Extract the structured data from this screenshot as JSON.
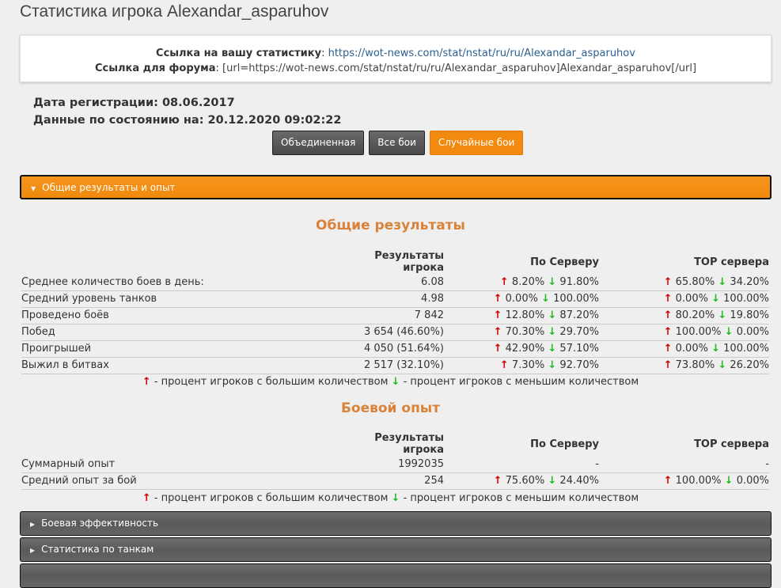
{
  "title": "Статистика игрока Alexandar_asparuhov",
  "links": {
    "stat_label": "Ссылка на вашу статистику",
    "stat_url": "https://wot-news.com/stat/nstat/ru/ru/Alexandar_asparuhov",
    "forum_label": "Ссылка для форума",
    "forum_code": "[url=https://wot-news.com/stat/nstat/ru/ru/Alexandar_asparuhov]Alexandar_asparuhov[/url]"
  },
  "info": {
    "reg": "Дата регистрации: 08.06.2017",
    "updated": "Данные по состоянию на: 20.12.2020 09:02:22"
  },
  "buttons": [
    "Объединенная",
    "Все бои",
    "Случайные бои"
  ],
  "accordion": {
    "open": "Общие результаты и опыт",
    "closed": [
      "Боевая эффективность",
      "Статистика по танкам"
    ]
  },
  "icons": {
    "up": "↑",
    "down": "↓",
    "arrow_open": "▼",
    "arrow_closed": "▶"
  },
  "headers": {
    "player": "Результаты игрока",
    "server": "По Серверу",
    "top": "TOP сервера"
  },
  "section1": {
    "title": "Общие результаты",
    "rows": [
      {
        "label": "Среднее количество боев в день:",
        "player": "6.08",
        "su": "8.20%",
        "sd": "91.80%",
        "tu": "65.80%",
        "td": "34.20%"
      },
      {
        "label": "Средний уровень танков",
        "player": "4.98",
        "su": "0.00%",
        "sd": "100.00%",
        "tu": "0.00%",
        "td": "100.00%"
      },
      {
        "label": "Проведено боёв",
        "player": "7 842",
        "su": "12.80%",
        "sd": "87.20%",
        "tu": "80.20%",
        "td": "19.80%"
      },
      {
        "label": "Побед",
        "player": "3 654 (46.60%)",
        "su": "70.30%",
        "sd": "29.70%",
        "tu": "100.00%",
        "td": "0.00%"
      },
      {
        "label": "Проигрышей",
        "player": "4 050 (51.64%)",
        "su": "42.90%",
        "sd": "57.10%",
        "tu": "0.00%",
        "td": "100.00%"
      },
      {
        "label": "Выжил в битвах",
        "player": "2 517 (32.10%)",
        "su": "7.30%",
        "sd": "92.70%",
        "tu": "73.80%",
        "td": "26.20%"
      }
    ]
  },
  "section2": {
    "title": "Боевой опыт",
    "rows": [
      {
        "label": "Суммарный опыт",
        "player": "1992035",
        "server": "-",
        "top": "-"
      },
      {
        "label": "Средний опыт за бой",
        "player": "254",
        "su": "75.60%",
        "sd": "24.40%",
        "tu": "100.00%",
        "td": "0.00%"
      }
    ]
  },
  "legend": {
    "up_text": " - процент игроков с большим количеством ",
    "down_text": " - процент игроков с меньшим количеством"
  }
}
